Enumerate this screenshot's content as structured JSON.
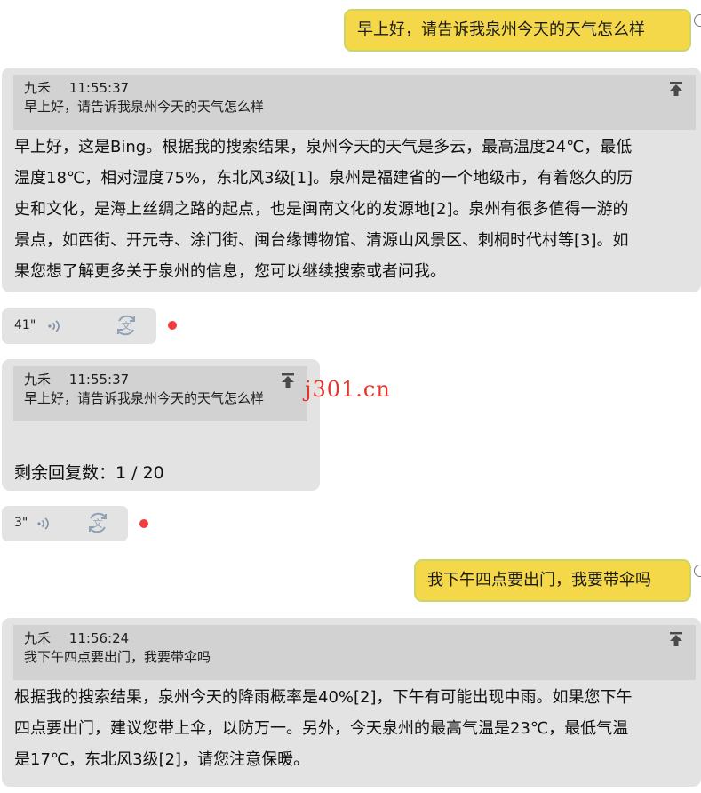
{
  "conversation": {
    "msg1_user": "早上好，请告诉我泉州今天的天气怎么样",
    "reply1": {
      "quote_sender": "九禾",
      "quote_time": "11:55:37",
      "quote_text": "早上好，请告诉我泉州今天的天气怎么样",
      "answer_lines": [
        "早上好，这是Bing。根据我的搜索结果，泉州今天的天气是多云，最高温度24℃，最低",
        "温度18℃，相对湿度75%，东北风3级[1]。泉州是福建省的一个地级市，有着悠久的历",
        "史和文化，是海上丝绸之路的起点，也是闽南文化的发源地[2]。泉州有很多值得一游的",
        "景点，如西街、开元寺、涂门街、闽台缘博物馆、清源山风景区、刺桐时代村等[3]。如",
        "果您想了解更多关于泉州的信息，您可以继续搜索或者问我。"
      ],
      "audio_duration": "41\""
    },
    "reply2": {
      "quote_sender": "九禾",
      "quote_time": "11:55:37",
      "quote_text": "早上好，请告诉我泉州今天的天气怎么样",
      "remaining_label": "剩余回复数：1 / 20",
      "audio_duration": "3\""
    },
    "watermark": "j301.cn",
    "msg2_user": "我下午四点要出门，我要带伞吗",
    "reply3": {
      "quote_sender": "九禾",
      "quote_time": "11:56:24",
      "quote_text": "我下午四点要出门，我要带伞吗",
      "answer_lines": [
        "根据我的搜索结果，泉州今天的降雨概率是40%[2]，下午有可能出现中雨。如果您下午",
        "四点要出门，建议您带上伞，以防万一。另外，今天泉州的最高气温是23℃，最低气温",
        "是17℃，东北风3级[2]，请您注意保暖。"
      ]
    }
  },
  "colors": {
    "user_bubble": "#f5d84a",
    "bot_card": "#e3e3e3",
    "quote_block": "#d2d2d2",
    "unread_dot": "#f43c3c",
    "watermark": "#e8322a"
  },
  "icons": [
    "pin-to-top-icon",
    "voice-wave-icon",
    "translate-icon"
  ]
}
